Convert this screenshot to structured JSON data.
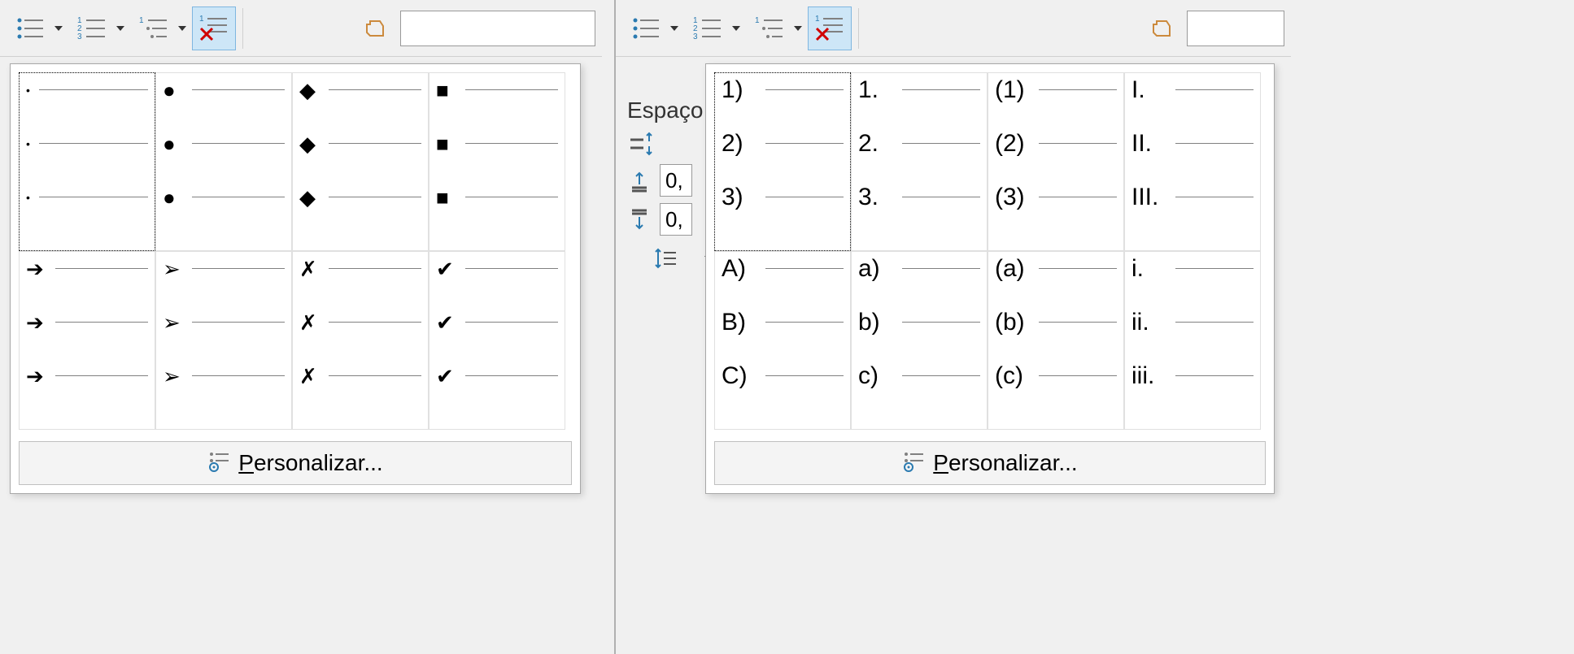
{
  "left": {
    "customize_label": "Personalizar...",
    "bullet_presets": [
      {
        "rows": [
          "•",
          "•",
          "•"
        ],
        "small": true,
        "selected": true
      },
      {
        "rows": [
          "●",
          "●",
          "●"
        ]
      },
      {
        "rows": [
          "◆",
          "◆",
          "◆"
        ]
      },
      {
        "rows": [
          "■",
          "■",
          "■"
        ]
      },
      {
        "rows": [
          "➔",
          "➔",
          "➔"
        ]
      },
      {
        "rows": [
          "➢",
          "➢",
          "➢"
        ]
      },
      {
        "rows": [
          "✗",
          "✗",
          "✗"
        ]
      },
      {
        "rows": [
          "✔",
          "✔",
          "✔"
        ]
      }
    ]
  },
  "right": {
    "customize_label": "Personalizar...",
    "sidebar_label_spacing": "Espaço",
    "spacing_above_value": "0,",
    "spacing_below_value": "0,",
    "number_presets": [
      {
        "rows": [
          "1)",
          "2)",
          "3)"
        ],
        "selected": true
      },
      {
        "rows": [
          "1.",
          "2.",
          "3."
        ]
      },
      {
        "rows": [
          "(1)",
          "(2)",
          "(3)"
        ]
      },
      {
        "rows": [
          "I.",
          "II.",
          "III."
        ]
      },
      {
        "rows": [
          "A)",
          "B)",
          "C)"
        ]
      },
      {
        "rows": [
          "a)",
          "b)",
          "c)"
        ]
      },
      {
        "rows": [
          "(a)",
          "(b)",
          "(c)"
        ]
      },
      {
        "rows": [
          "i.",
          "ii.",
          "iii."
        ]
      }
    ]
  }
}
